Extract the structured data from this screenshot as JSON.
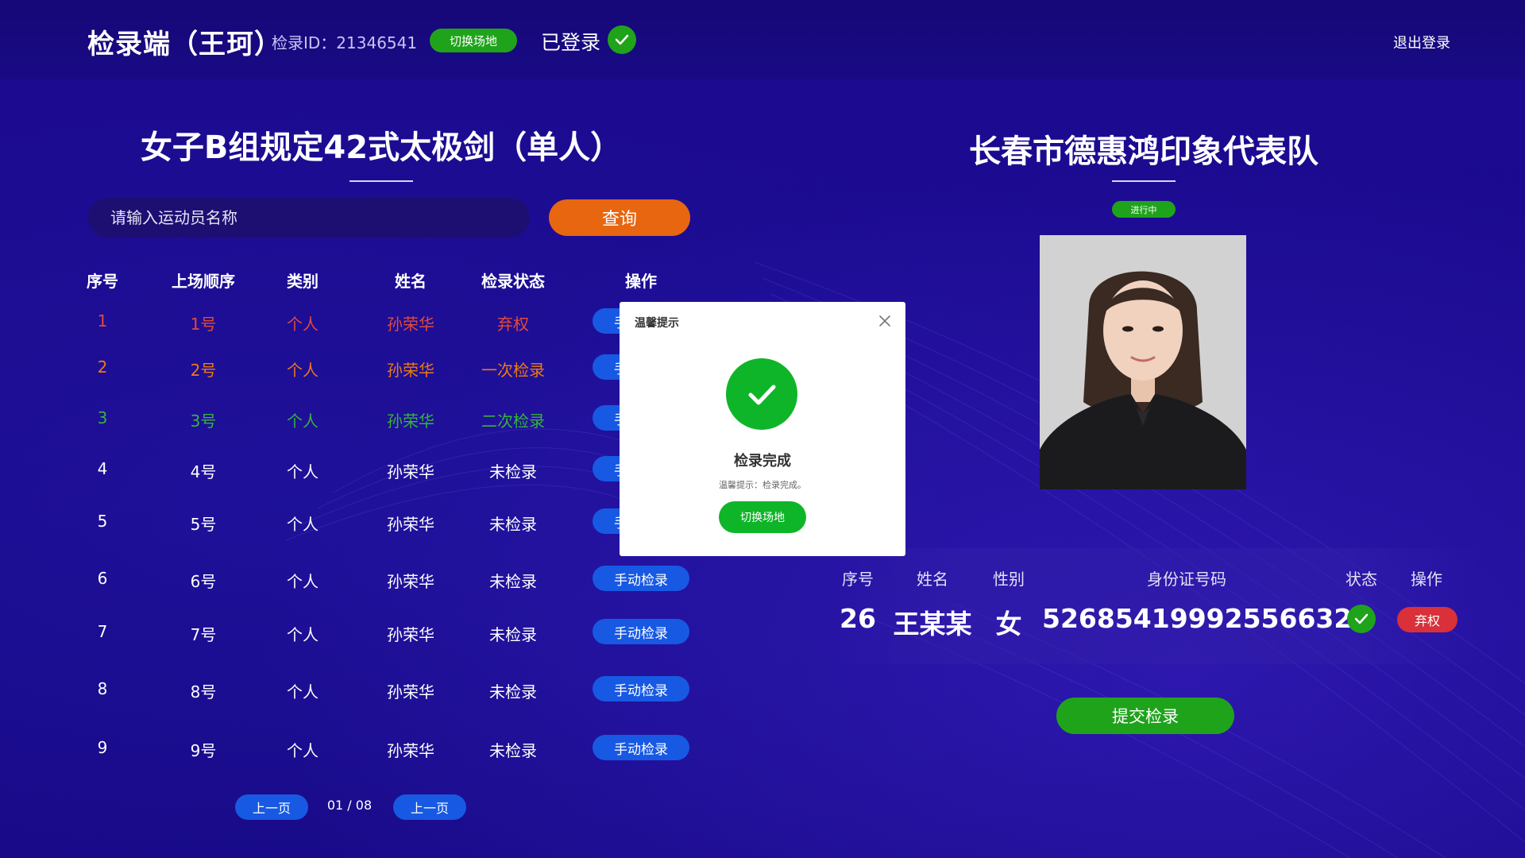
{
  "header": {
    "app_title": "检录端（王珂）",
    "checkin_id": "检录ID：21346541",
    "switch_venue_label": "切换场地",
    "logged_in_label": "已登录",
    "logout_label": "退出登录"
  },
  "event": {
    "title": "女子B组规定42式太极剑（单人）",
    "search_placeholder": "请输入运动员名称",
    "query_label": "查询"
  },
  "table": {
    "headers": [
      "序号",
      "上场顺序",
      "类别",
      "姓名",
      "检录状态",
      "操作"
    ],
    "action_label": "手动检录",
    "rows": [
      {
        "index": "1",
        "order": "1号",
        "category": "个人",
        "name": "孙荣华",
        "status": "弃权",
        "color": "#e24a3b"
      },
      {
        "index": "2",
        "order": "2号",
        "category": "个人",
        "name": "孙荣华",
        "status": "一次检录",
        "color": "#ec7a13"
      },
      {
        "index": "3",
        "order": "3号",
        "category": "个人",
        "name": "孙荣华",
        "status": "二次检录",
        "color": "#35b43a"
      },
      {
        "index": "4",
        "order": "4号",
        "category": "个人",
        "name": "孙荣华",
        "status": "未检录",
        "color": "#ffffff"
      },
      {
        "index": "5",
        "order": "5号",
        "category": "个人",
        "name": "孙荣华",
        "status": "未检录",
        "color": "#ffffff"
      },
      {
        "index": "6",
        "order": "6号",
        "category": "个人",
        "name": "孙荣华",
        "status": "未检录",
        "color": "#ffffff"
      },
      {
        "index": "7",
        "order": "7号",
        "category": "个人",
        "name": "孙荣华",
        "status": "未检录",
        "color": "#ffffff"
      },
      {
        "index": "8",
        "order": "8号",
        "category": "个人",
        "name": "孙荣华",
        "status": "未检录",
        "color": "#ffffff"
      },
      {
        "index": "9",
        "order": "9号",
        "category": "个人",
        "name": "孙荣华",
        "status": "未检录",
        "color": "#ffffff"
      }
    ]
  },
  "pagination": {
    "prev_label": "上一页",
    "page_indicator": "01 / 08",
    "next_label": "上一页"
  },
  "team": {
    "title": "长春市德惠鸿印象代表队",
    "status_pill": "进行中",
    "headers": {
      "index": "序号",
      "name": "姓名",
      "gender": "性别",
      "id_number": "身份证号码",
      "status": "状态",
      "action": "操作"
    },
    "athlete": {
      "index": "26",
      "name": "王某某",
      "gender": "女",
      "id_number": "526854199925566325"
    },
    "waive_label": "弃权",
    "submit_label": "提交检录"
  },
  "modal": {
    "title": "温馨提示",
    "heading": "检录完成",
    "message": "温馨提示：检录完成。",
    "button_label": "切换场地"
  },
  "colors": {
    "background": "#1a0a8c",
    "success": "#1fa31b",
    "primary_button": "#1759e3",
    "query_button": "#e8660f",
    "danger": "#d9303a"
  }
}
